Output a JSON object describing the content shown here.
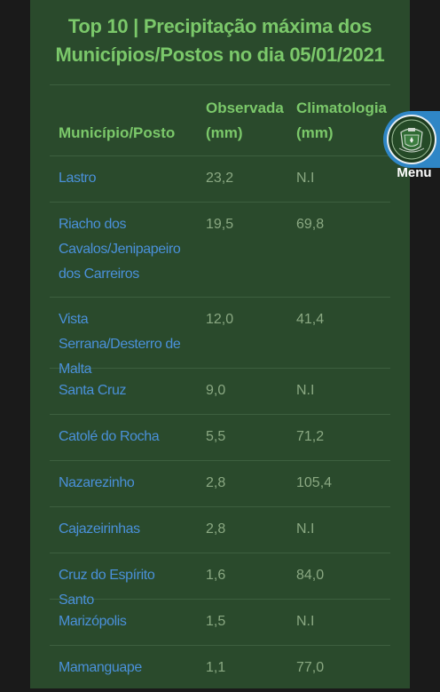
{
  "title": "Top 10 | Precipitação máxima dos Municípios/Postos no dia 05/01/2021",
  "table": {
    "headers": [
      "Município/Posto",
      "Observada (mm)",
      "Climatologia (mm)"
    ],
    "rows": [
      {
        "name": "Lastro",
        "observed": "23,2",
        "climatology": "N.I"
      },
      {
        "name": "Riacho dos Cavalos/Jenipapeiro dos Carreiros",
        "observed": "19,5",
        "climatology": "69,8"
      },
      {
        "name": "Vista Serrana/Desterro de Malta",
        "observed": "12,0",
        "climatology": "41,4"
      },
      {
        "name": "Santa Cruz",
        "observed": "9,0",
        "climatology": "N.I"
      },
      {
        "name": "Catolé do Rocha",
        "observed": "5,5",
        "climatology": "71,2"
      },
      {
        "name": "Nazarezinho",
        "observed": "2,8",
        "climatology": "105,4"
      },
      {
        "name": "Cajazeirinhas",
        "observed": "2,8",
        "climatology": "N.I"
      },
      {
        "name": "Cruz do Espírito Santo",
        "observed": "1,6",
        "climatology": "84,0"
      },
      {
        "name": "Marizópolis",
        "observed": "1,5",
        "climatology": "N.I"
      },
      {
        "name": "Mamanguape",
        "observed": "1,1",
        "climatology": "77,0"
      }
    ]
  },
  "menu": {
    "label": "Menu",
    "icon": "state-coat-of-arms-icon"
  },
  "colors": {
    "title": "#7bc86a",
    "link": "#4a90d9",
    "value": "#8aa882",
    "panel": "#2a4a2c",
    "menu_bg": "#2f86c6"
  }
}
